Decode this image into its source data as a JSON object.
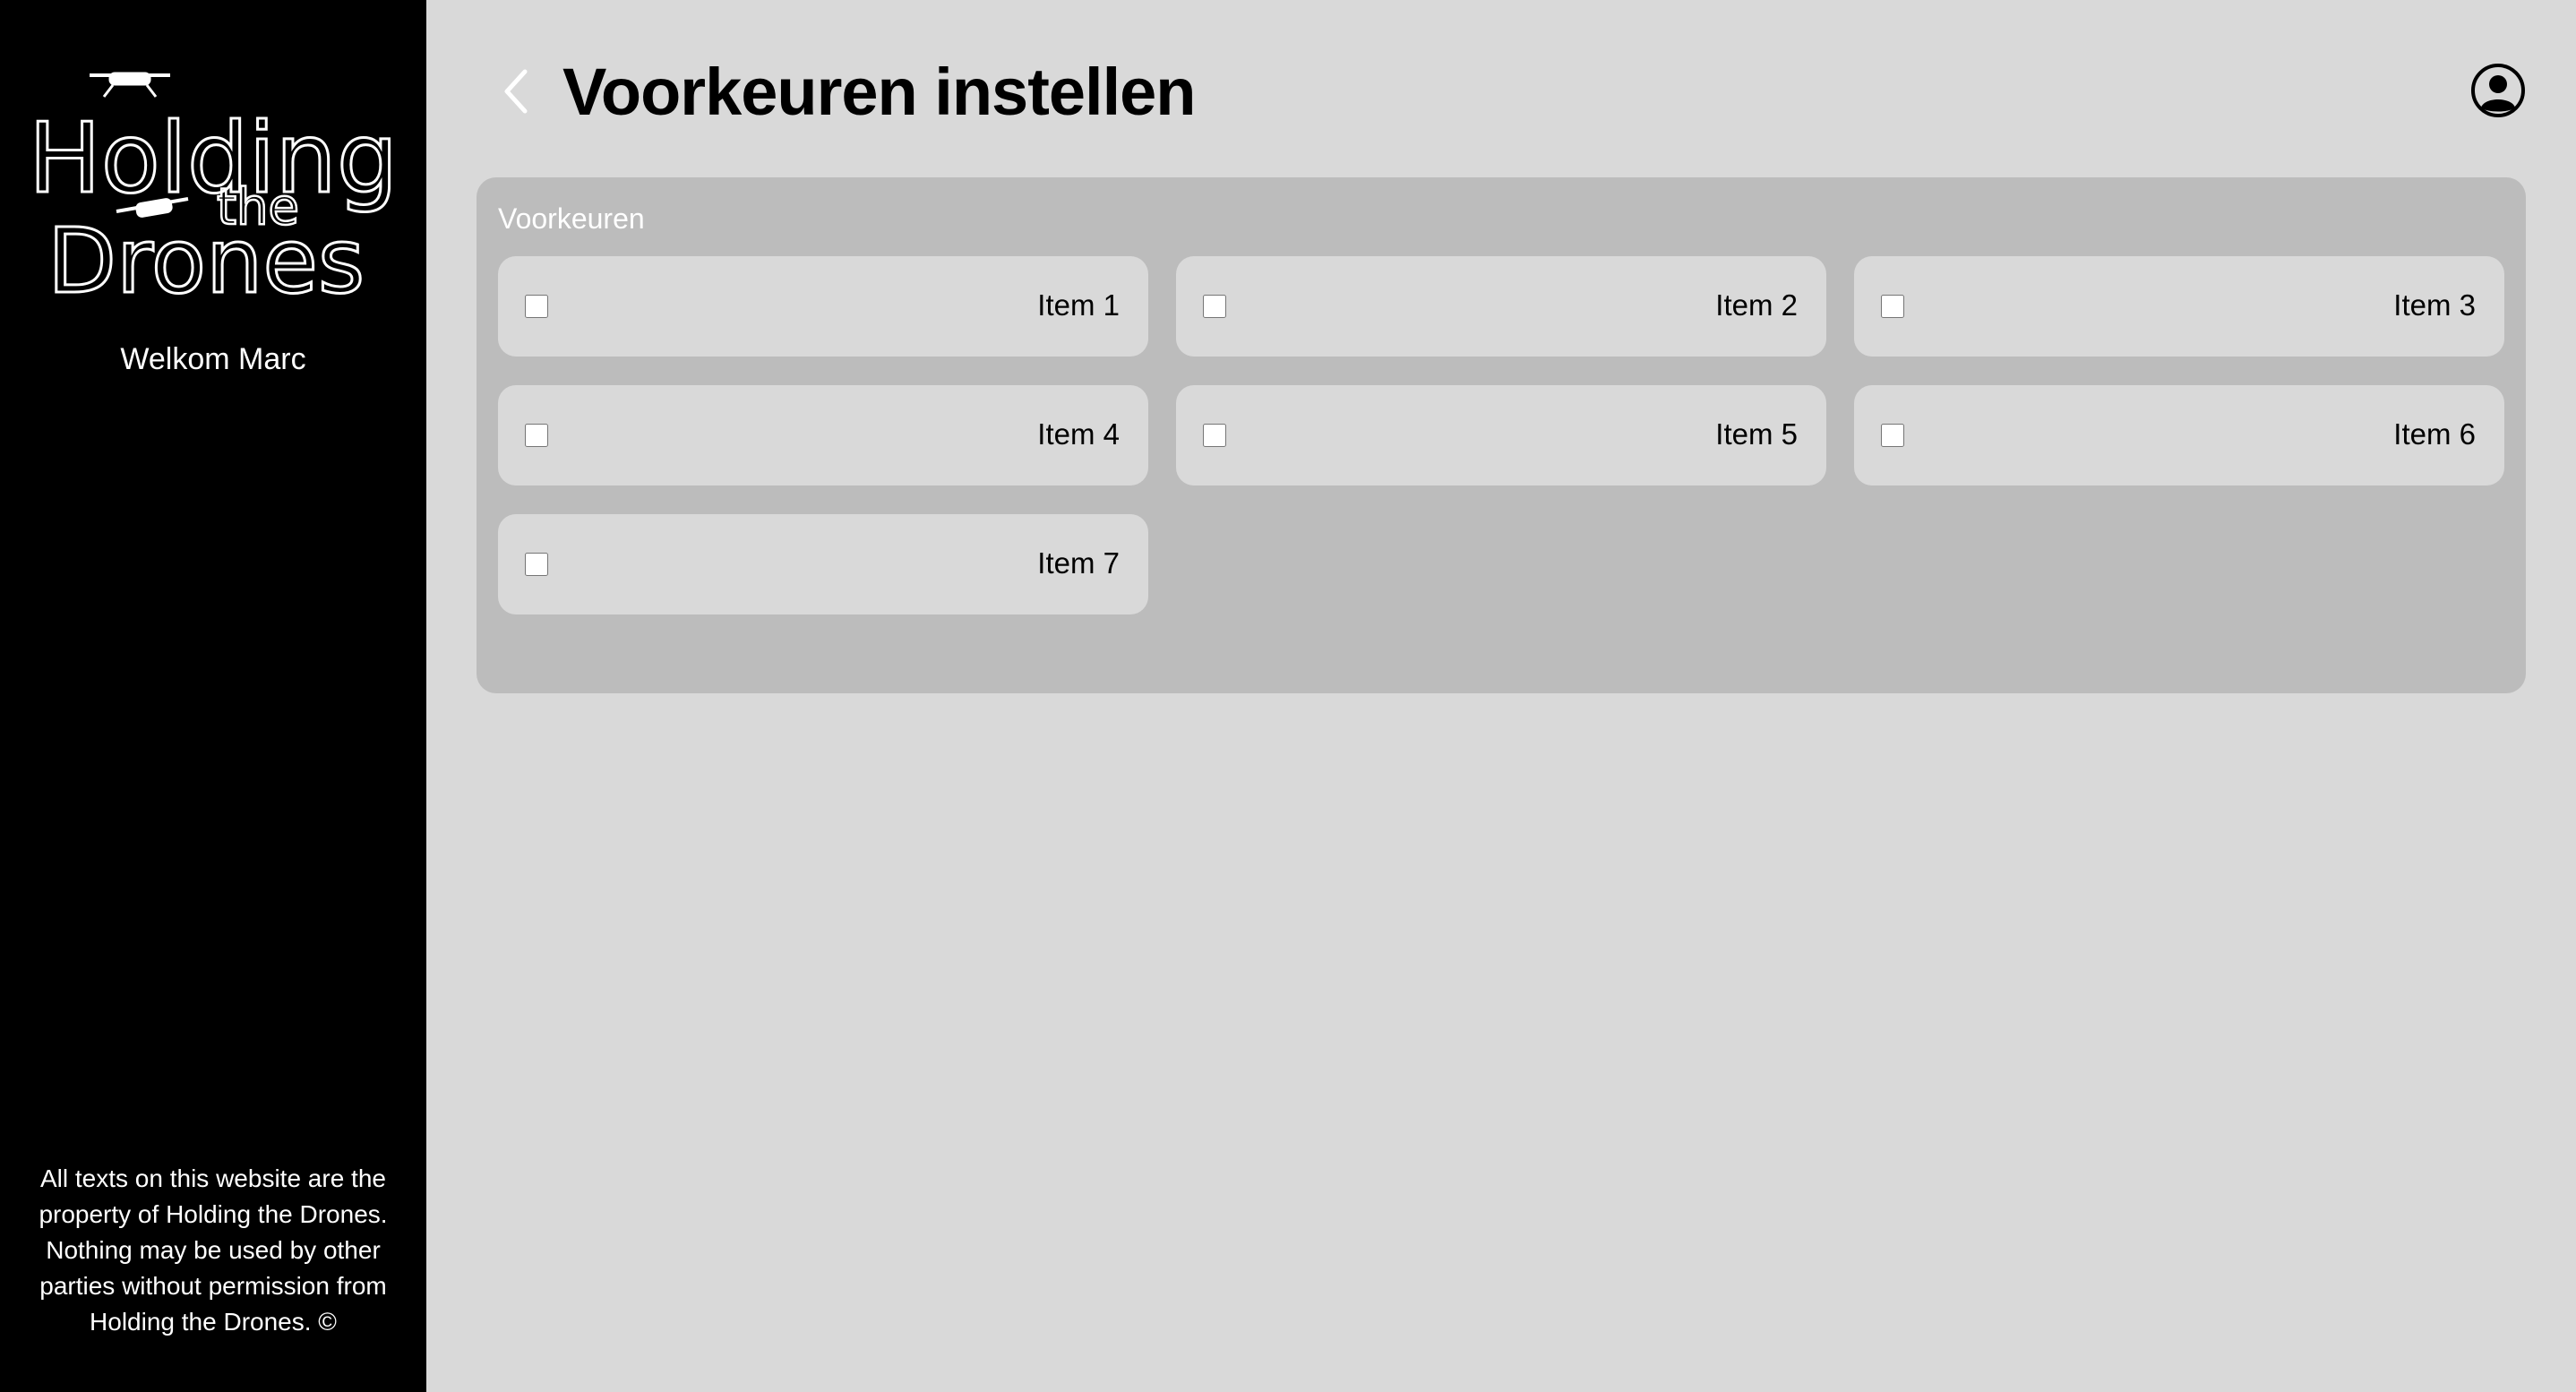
{
  "sidebar": {
    "logo": {
      "line1": "Holding",
      "line2": "the",
      "line3": "Drones"
    },
    "welcome": "Welkom Marc",
    "footer_note": "All texts on this website are the property of Holding the Drones. Nothing may be used by other parties without permission from Holding the Drones. ©"
  },
  "header": {
    "title": "Voorkeuren instellen",
    "back_icon": "chevron-left-icon",
    "user_icon": "user-circle-icon"
  },
  "preferences": {
    "section_title": "Voorkeuren",
    "items": [
      {
        "label": "Item 1",
        "checked": false
      },
      {
        "label": "Item 2",
        "checked": false
      },
      {
        "label": "Item 3",
        "checked": false
      },
      {
        "label": "Item 4",
        "checked": false
      },
      {
        "label": "Item 5",
        "checked": false
      },
      {
        "label": "Item 6",
        "checked": false
      },
      {
        "label": "Item 7",
        "checked": false
      }
    ]
  },
  "colors": {
    "sidebar_bg": "#000000",
    "page_bg": "#d9d9d9",
    "panel_bg": "#bcbcbc",
    "card_bg": "#d9d9d9"
  }
}
